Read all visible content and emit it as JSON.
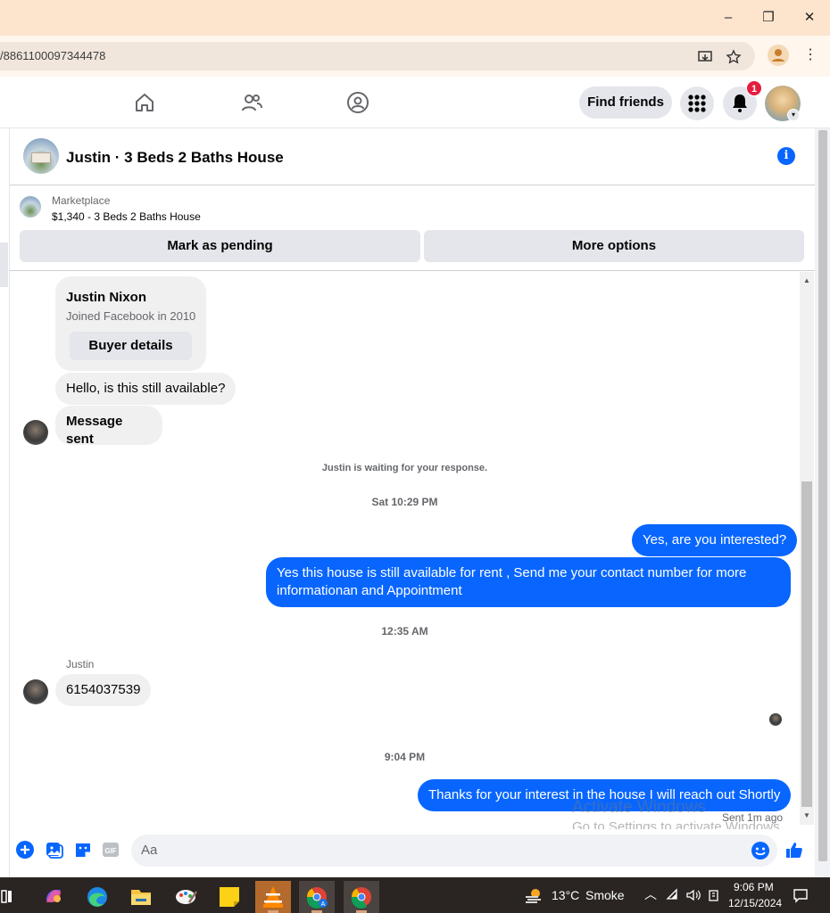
{
  "browser": {
    "url_fragment": "/8861100097344478",
    "window_controls": {
      "minimize": "–",
      "restore": "❐",
      "close": "✕"
    }
  },
  "fb_nav": {
    "find_friends_label": "Find friends",
    "notification_count": "1"
  },
  "chat": {
    "title": "Justin · 3 Beds 2 Baths House",
    "marketplace_label": "Marketplace",
    "listing": "$1,340 - 3 Beds 2 Baths House",
    "mark_pending_label": "Mark as pending",
    "more_options_label": "More options",
    "buyer_card": {
      "name": "Justin Nixon",
      "joined": "Joined Facebook in 2010",
      "button": "Buyer details"
    },
    "messages": [
      {
        "from": "them",
        "text": "Hello, is this still available?"
      },
      {
        "from": "them",
        "text": "Message sent"
      },
      {
        "meta": "Justin is waiting for your response."
      },
      {
        "meta": "Sat 10:29 PM"
      },
      {
        "from": "me",
        "text": "Yes, are you interested?"
      },
      {
        "from": "me",
        "text": "Yes this house is still available for rent , Send me your contact number for more informationan and Appointment"
      },
      {
        "meta": "12:35 AM"
      },
      {
        "sender": "Justin"
      },
      {
        "from": "them",
        "text": "6154037539"
      },
      {
        "meta": "9:04 PM"
      },
      {
        "from": "me",
        "text": "Thanks for your interest in the house I will reach out Shortly"
      }
    ],
    "sent_status": "Sent 1m ago",
    "composer_placeholder": "Aa"
  },
  "watermark": {
    "line1": "Activate Windows",
    "line2": "Go to Settings to activate Windows."
  },
  "taskbar": {
    "weather_temp": "13°C",
    "weather_desc": "Smoke",
    "time": "9:06 PM",
    "date": "12/15/2024"
  },
  "colors": {
    "accent": "#0866ff",
    "titlebar": "#fde4cd",
    "bubble_in": "#f0f0f0",
    "badge": "#e41e3f"
  }
}
